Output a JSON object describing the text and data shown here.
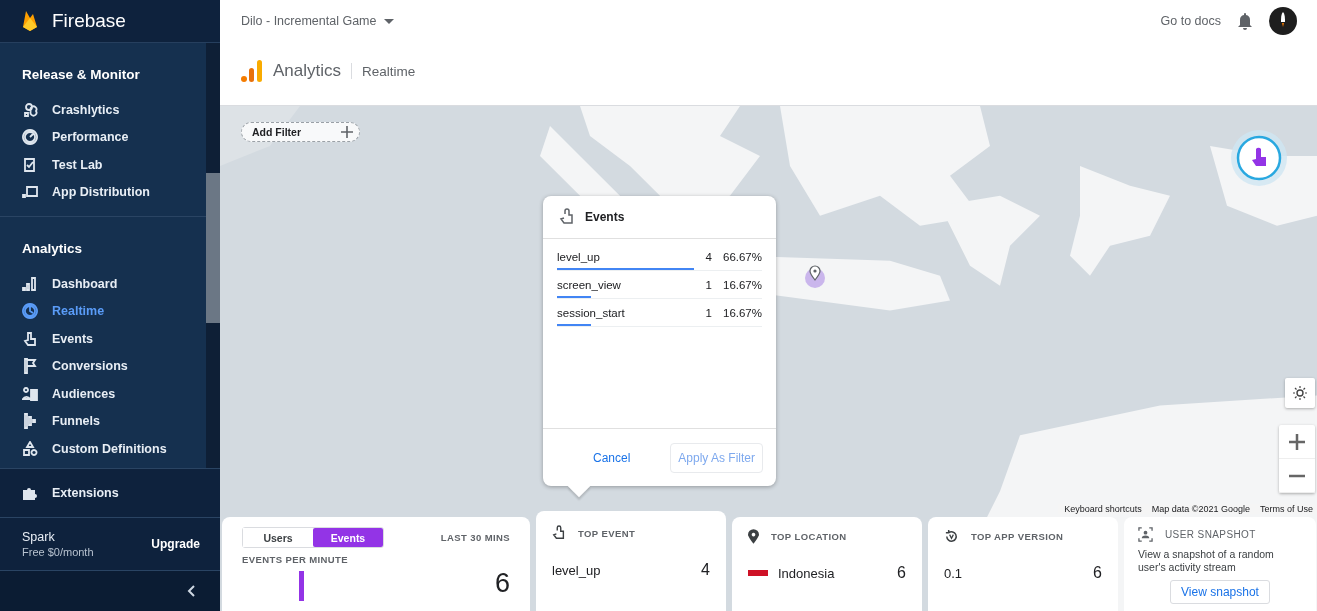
{
  "sidebar": {
    "brand": "Firebase",
    "sections": [
      {
        "title": "Release & Monitor",
        "items": [
          {
            "label": "Crashlytics",
            "selected": false
          },
          {
            "label": "Performance",
            "selected": false
          },
          {
            "label": "Test Lab",
            "selected": false
          },
          {
            "label": "App Distribution",
            "selected": false
          }
        ]
      },
      {
        "title": "Analytics",
        "items": [
          {
            "label": "Dashboard",
            "selected": false
          },
          {
            "label": "Realtime",
            "selected": true
          },
          {
            "label": "Events",
            "selected": false
          },
          {
            "label": "Conversions",
            "selected": false
          },
          {
            "label": "Audiences",
            "selected": false
          },
          {
            "label": "Funnels",
            "selected": false
          },
          {
            "label": "Custom Definitions",
            "selected": false
          }
        ]
      }
    ],
    "extensions": "Extensions",
    "plan": {
      "name": "Spark",
      "price": "Free $0/month",
      "action": "Upgrade"
    }
  },
  "header": {
    "project": "Dilo - Incremental Game",
    "docs_link": "Go to docs",
    "product": "Analytics",
    "page": "Realtime"
  },
  "map": {
    "add_filter": "Add Filter",
    "attribution": [
      "Keyboard shortcuts",
      "Map data ©2021 Google",
      "Terms of Use"
    ]
  },
  "popup": {
    "title": "Events",
    "rows": [
      {
        "name": "level_up",
        "count": "4",
        "share": "66.67%",
        "level": 0.6667
      },
      {
        "name": "screen_view",
        "count": "1",
        "share": "16.67%",
        "level": 0.1667
      },
      {
        "name": "session_start",
        "count": "1",
        "share": "16.67%",
        "level": 0.1667
      }
    ],
    "cancel": "Cancel",
    "apply": {
      "label": "Apply As Filter",
      "disabled": true
    }
  },
  "cards": {
    "activity": {
      "toggle": [
        {
          "label": "Users",
          "selected": false
        },
        {
          "label": "Events",
          "selected": true
        }
      ],
      "period": "LAST 30 MINS",
      "subtitle": "EVENTS PER MINUTE",
      "total": "6"
    },
    "top_event": {
      "title": "TOP EVENT",
      "name": "level_up",
      "value": "4"
    },
    "top_location": {
      "title": "TOP LOCATION",
      "name": "Indonesia",
      "value": "6"
    },
    "top_app_version": {
      "title": "TOP APP VERSION",
      "name": "0.1",
      "value": "6"
    },
    "user_snapshot": {
      "title": "USER SNAPSHOT",
      "text": "View a snapshot of a random user's activity stream",
      "button": "View snapshot"
    }
  }
}
